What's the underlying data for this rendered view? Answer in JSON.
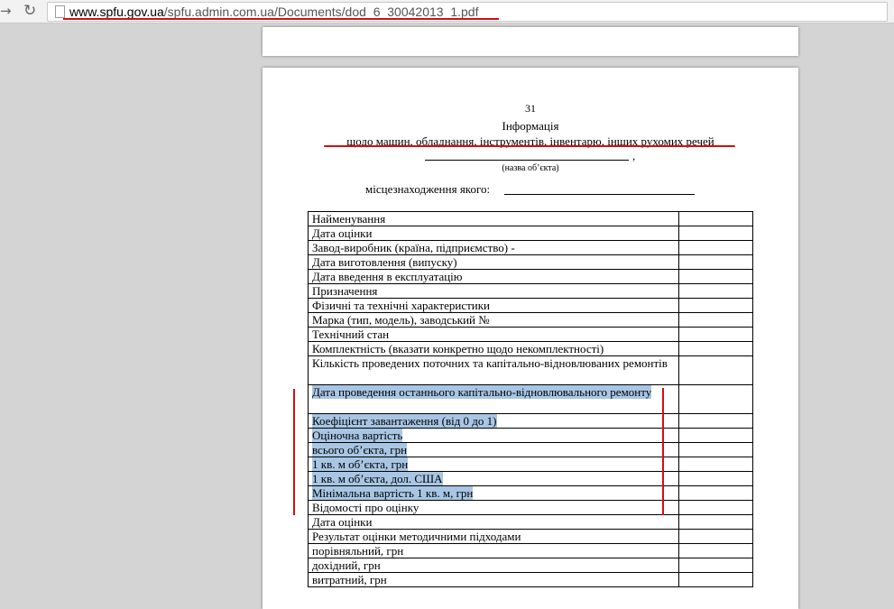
{
  "browser": {
    "url_host": "www.spfu.gov.ua",
    "url_path": "/spfu.admin.com.ua/Documents/dod_6_30042013_1.pdf"
  },
  "document": {
    "page_number": "31",
    "title": "Інформація",
    "subtitle": "щодо машин, обладнання, інструментів, інвентарю, інших рухомих речей",
    "object_name_comma": ",",
    "object_name_caption": "(назва об’єкта)",
    "location_label": "місцезнаходження якого:",
    "rows": [
      {
        "label": "Найменування"
      },
      {
        "label": "Дата оцінки"
      },
      {
        "label": "Завод-виробник (країна, підприємство) -"
      },
      {
        "label": "Дата виготовлення (випуску)"
      },
      {
        "label": "Дата введення в експлуатацію"
      },
      {
        "label": "Призначення"
      },
      {
        "label": "Фізичні та технічні характеристики"
      },
      {
        "label": "Марка (тип, модель), заводський №"
      },
      {
        "label": "Технічний стан"
      },
      {
        "label": "Комплектність (вказати конкретно щодо некомплектності)"
      },
      {
        "label": "Кількість проведених поточних та капітально-відновлюваних ремонтів"
      },
      {
        "label": "Дата проведення останнього капітально-відновлювального ремонту"
      },
      {
        "label": "Коефіцієнт завантаження (від 0 до 1)"
      },
      {
        "label": "Оціночна вартість"
      },
      {
        "label": "всього об’єкта, грн"
      },
      {
        "label": "1 кв. м об’єкта, грн"
      },
      {
        "label": "1 кв. м об’єкта, дол. США"
      },
      {
        "label": "Мінімальна вартість 1 кв. м, грн"
      },
      {
        "label": "Відомості про оцінку"
      },
      {
        "label": "Дата оцінки"
      },
      {
        "label": "Результат оцінки методичними підходами"
      },
      {
        "label": "порівняльний, грн"
      },
      {
        "label": "дохідний, грн"
      },
      {
        "label": "витратний, грн"
      }
    ]
  }
}
